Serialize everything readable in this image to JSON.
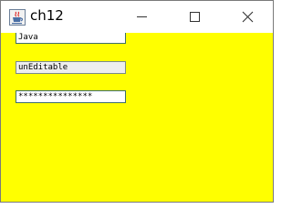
{
  "window": {
    "title": "ch12",
    "icon": "java-cup-icon",
    "controls": [
      "minimize",
      "maximize",
      "close"
    ]
  },
  "content": {
    "background": "#ffff00",
    "fields": [
      {
        "value": "Java",
        "editable": true
      },
      {
        "value": "unEditable",
        "editable": false
      },
      {
        "value": "***************",
        "type": "password"
      }
    ]
  }
}
